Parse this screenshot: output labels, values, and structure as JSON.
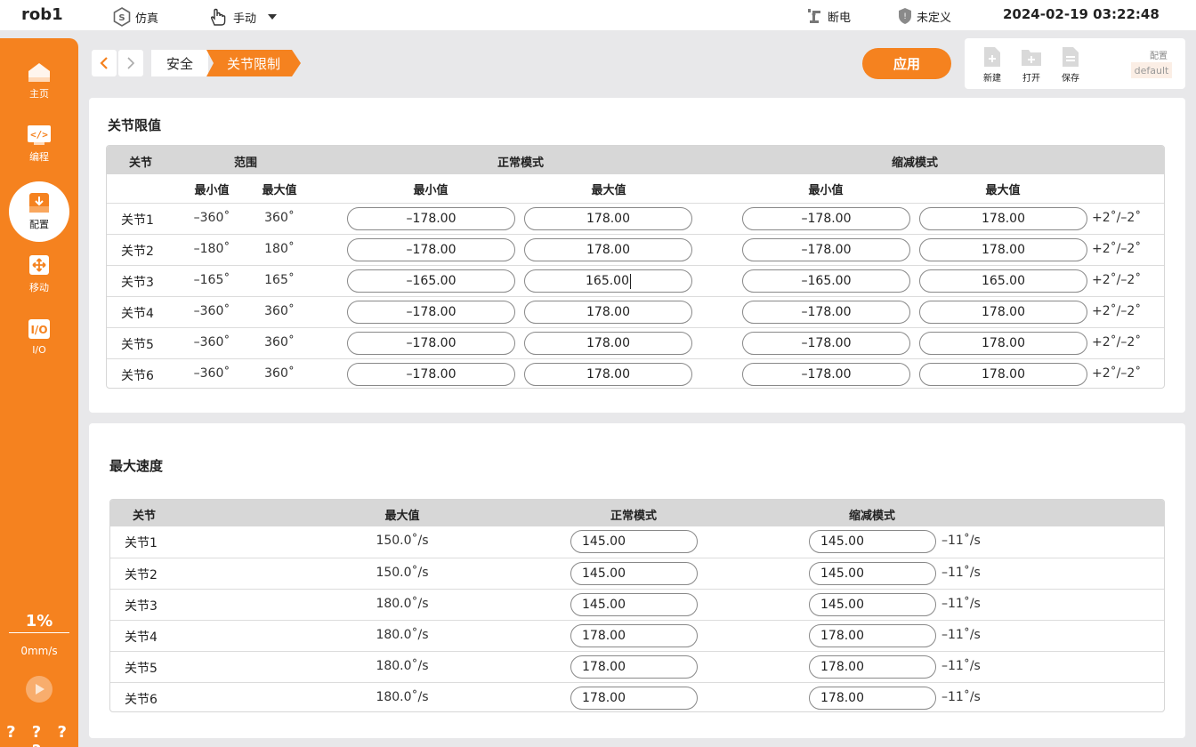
{
  "topbar": {
    "robot_name": "rob1",
    "sim_label": "仿真",
    "mode_label": "手动",
    "power_label": "断电",
    "safety_label": "未定义",
    "datetime": "2024-02-19 03:22:48"
  },
  "sidebar": {
    "items": [
      {
        "label": "主页",
        "icon": "home-icon"
      },
      {
        "label": "编程",
        "icon": "code-icon"
      },
      {
        "label": "配置",
        "icon": "config-icon"
      },
      {
        "label": "移动",
        "icon": "move-icon"
      },
      {
        "label": "I/O",
        "icon": "io-icon"
      }
    ],
    "speed_percent": "1%",
    "speed_mm": "0mm/s",
    "status": "? ? ? ?"
  },
  "breadcrumb": [
    "安全",
    "关节限制"
  ],
  "toolbar": {
    "apply_label": "应用",
    "new_label": "新建",
    "open_label": "打开",
    "save_label": "保存",
    "config_label": "配置",
    "config_value": "default"
  },
  "joint_limits": {
    "title": "关节限值",
    "headers": {
      "joint": "关节",
      "range": "范围",
      "normal": "正常模式",
      "reduced": "缩减模式"
    },
    "subheaders": {
      "range_min": "最小值",
      "range_max": "最大值",
      "normal_min": "最小值",
      "normal_max": "最大值",
      "reduced_min": "最小值",
      "reduced_max": "最大值"
    },
    "rows": [
      {
        "joint": "关节1",
        "range_min": "–360˚",
        "range_max": "360˚",
        "normal_min": "–178.00",
        "normal_max": "178.00",
        "reduced_min": "–178.00",
        "reduced_max": "178.00",
        "tolerance": "+2˚/–2˚"
      },
      {
        "joint": "关节2",
        "range_min": "–180˚",
        "range_max": "180˚",
        "normal_min": "–178.00",
        "normal_max": "178.00",
        "reduced_min": "–178.00",
        "reduced_max": "178.00",
        "tolerance": "+2˚/–2˚"
      },
      {
        "joint": "关节3",
        "range_min": "–165˚",
        "range_max": "165˚",
        "normal_min": "–165.00",
        "normal_max": "165.00",
        "reduced_min": "–165.00",
        "reduced_max": "165.00",
        "tolerance": "+2˚/–2˚"
      },
      {
        "joint": "关节4",
        "range_min": "–360˚",
        "range_max": "360˚",
        "normal_min": "–178.00",
        "normal_max": "178.00",
        "reduced_min": "–178.00",
        "reduced_max": "178.00",
        "tolerance": "+2˚/–2˚"
      },
      {
        "joint": "关节5",
        "range_min": "–360˚",
        "range_max": "360˚",
        "normal_min": "–178.00",
        "normal_max": "178.00",
        "reduced_min": "–178.00",
        "reduced_max": "178.00",
        "tolerance": "+2˚/–2˚"
      },
      {
        "joint": "关节6",
        "range_min": "–360˚",
        "range_max": "360˚",
        "normal_min": "–178.00",
        "normal_max": "178.00",
        "reduced_min": "–178.00",
        "reduced_max": "178.00",
        "tolerance": "+2˚/–2˚"
      }
    ]
  },
  "max_speed": {
    "title": "最大速度",
    "headers": {
      "joint": "关节",
      "max": "最大值",
      "normal": "正常模式",
      "reduced": "缩减模式"
    },
    "rows": [
      {
        "joint": "关节1",
        "max": "150.0˚/s",
        "normal": "145.00",
        "reduced": "145.00",
        "tolerance": "–11˚/s"
      },
      {
        "joint": "关节2",
        "max": "150.0˚/s",
        "normal": "145.00",
        "reduced": "145.00",
        "tolerance": "–11˚/s"
      },
      {
        "joint": "关节3",
        "max": "180.0˚/s",
        "normal": "145.00",
        "reduced": "145.00",
        "tolerance": "–11˚/s"
      },
      {
        "joint": "关节4",
        "max": "180.0˚/s",
        "normal": "178.00",
        "reduced": "178.00",
        "tolerance": "–11˚/s"
      },
      {
        "joint": "关节5",
        "max": "180.0˚/s",
        "normal": "178.00",
        "reduced": "178.00",
        "tolerance": "–11˚/s"
      },
      {
        "joint": "关节6",
        "max": "180.0˚/s",
        "normal": "178.00",
        "reduced": "178.00",
        "tolerance": "–11˚/s"
      }
    ]
  },
  "colors": {
    "accent": "#f5821f",
    "header_bg": "#d7d7d7",
    "page_bg": "#e8e8ea"
  }
}
